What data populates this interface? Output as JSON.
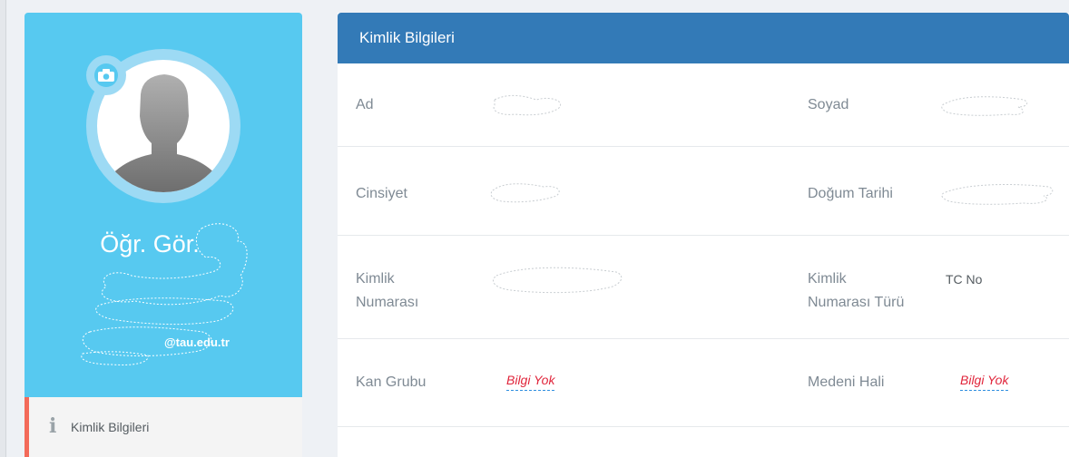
{
  "profile": {
    "title": "Öğr. Gör.",
    "email": "@tau.edu.tr",
    "menu": [
      {
        "label": "Kimlik Bilgileri",
        "icon": "info-icon",
        "active": true
      }
    ]
  },
  "panel": {
    "title": "Kimlik Bilgileri",
    "fields": {
      "ad": {
        "label": "Ad",
        "value": ""
      },
      "soyad": {
        "label": "Soyad",
        "value": ""
      },
      "cinsiyet": {
        "label": "Cinsiyet",
        "value": ""
      },
      "dogum_tarihi": {
        "label": "Doğum Tarihi",
        "value": ""
      },
      "kimlik_numarasi": {
        "label_line1": "Kimlik",
        "label_line2": "Numarası",
        "value": ""
      },
      "kimlik_numarasi_turu": {
        "label_line1": "Kimlik",
        "label_line2": "Numarası Türü",
        "value": "TC No"
      },
      "kan_grubu": {
        "label": "Kan Grubu",
        "value": "Bilgi Yok"
      },
      "medeni_hali": {
        "label": "Medeni Hali",
        "value": "Bilgi Yok"
      }
    }
  },
  "colors": {
    "profile_bg": "#57c9f0",
    "header_bg": "#337ab7",
    "active_menu_border": "#f36a5a",
    "missing_value": "#e0263c"
  }
}
